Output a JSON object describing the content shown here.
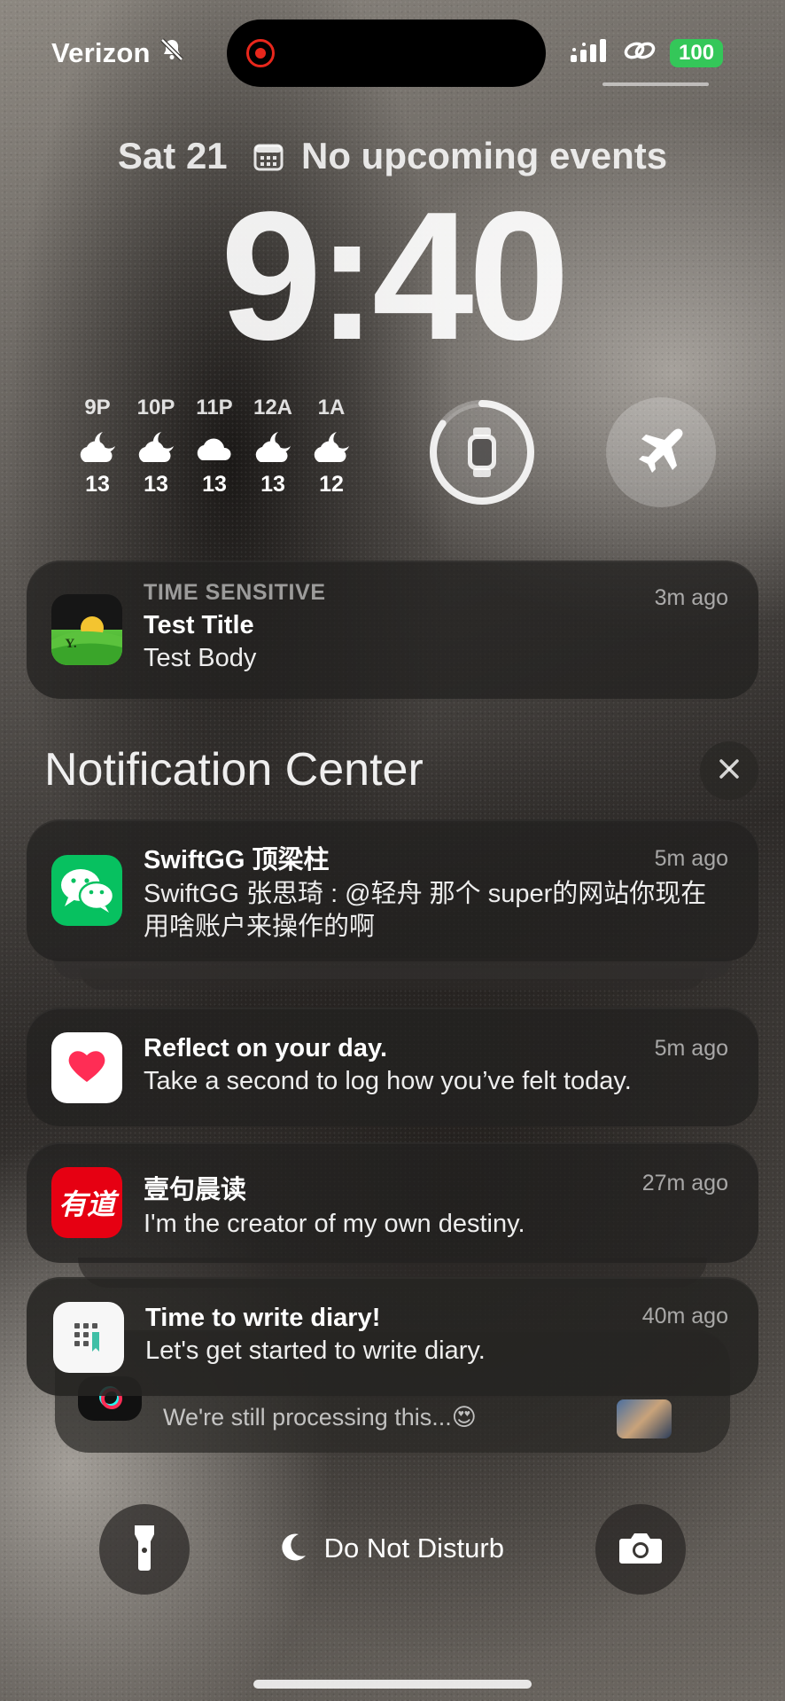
{
  "status_bar": {
    "carrier": "Verizon",
    "battery": "100",
    "icons": [
      "bell-slash-icon",
      "screen-record-icon",
      "signal-icon",
      "link-icon",
      "battery-icon"
    ]
  },
  "lock_screen": {
    "date": "Sat 21",
    "calendar_text": "No upcoming events",
    "time": "9:40"
  },
  "weather": [
    {
      "hour": "9P",
      "temp": "13",
      "icon": "cloud-moon-icon"
    },
    {
      "hour": "10P",
      "temp": "13",
      "icon": "cloud-moon-icon"
    },
    {
      "hour": "11P",
      "temp": "13",
      "icon": "cloud-icon"
    },
    {
      "hour": "12A",
      "temp": "13",
      "icon": "cloud-moon-icon"
    },
    {
      "hour": "1A",
      "temp": "12",
      "icon": "cloud-moon-icon"
    }
  ],
  "widgets": {
    "watch_ring_fraction": 0.85,
    "airplane": "airplane-icon"
  },
  "time_sensitive": {
    "tag": "TIME SENSITIVE",
    "title": "Test Title",
    "body": "Test Body",
    "time": "3m ago",
    "app_icon_text": "Y."
  },
  "notification_center": {
    "title": "Notification Center",
    "items": [
      {
        "app": "wechat",
        "title": "SwiftGG 顶梁柱",
        "body": "SwiftGG 张思琦 : @轻舟 那个 super的网站你现在用啥账户来操作的啊",
        "time": "5m ago"
      },
      {
        "app": "health",
        "title": "Reflect on your day.",
        "body": "Take a second to log how you’ve felt today.",
        "time": "5m ago"
      },
      {
        "app": "youdao",
        "icon_text": "有道",
        "title": "壹句晨读",
        "body": "I'm the creator of my own destiny.",
        "time": "27m ago"
      },
      {
        "app": "diary",
        "title": "Time to write diary!",
        "body": "Let's get started to write diary.",
        "time": "40m ago"
      }
    ],
    "peek_item": {
      "body": "We're still processing this...😍"
    }
  },
  "bottom": {
    "dnd_label": "Do Not Disturb",
    "left_button": "flashlight-icon",
    "right_button": "camera-icon"
  },
  "colors": {
    "battery_green": "#34c759",
    "record_red": "#e8271c",
    "wechat_green": "#07c160",
    "youdao_red": "#e60012",
    "health_pink": "#ff2d55"
  }
}
